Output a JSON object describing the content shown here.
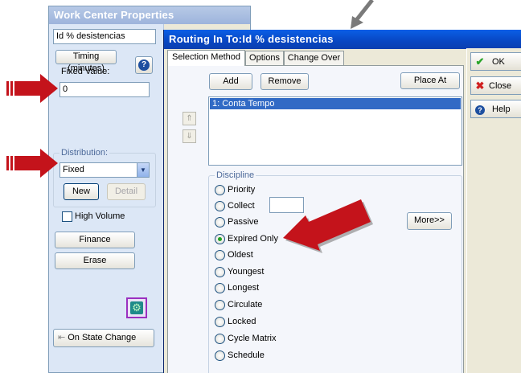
{
  "work_center": {
    "title": "Work Center Properties",
    "name_value": "Id % desistencias",
    "timing_label": "Timing (minutes)",
    "fixed_value_label": "Fixed Value:",
    "fixed_value": "0",
    "distribution_label": "Distribution:",
    "distribution_value": "Fixed",
    "new_label": "New",
    "detail_label": "Detail",
    "high_volume_label": "High Volume",
    "finance_label": "Finance",
    "erase_label": "Erase",
    "on_state_change_label": "On State Change"
  },
  "routing": {
    "title": "Routing In To:Id % desistencias",
    "tabs": [
      {
        "label": "Selection Method"
      },
      {
        "label": "Options"
      },
      {
        "label": "Change Over"
      }
    ],
    "add_label": "Add",
    "remove_label": "Remove",
    "place_at_label": "Place At",
    "list_items": [
      "1: Conta Tempo"
    ],
    "discipline_label": "Discipline",
    "options": [
      {
        "label": "Priority",
        "checked": false
      },
      {
        "label": "Collect",
        "checked": false
      },
      {
        "label": "Passive",
        "checked": false
      },
      {
        "label": "Expired Only",
        "checked": true
      },
      {
        "label": "Oldest",
        "checked": false
      },
      {
        "label": "Youngest",
        "checked": false
      },
      {
        "label": "Longest",
        "checked": false
      },
      {
        "label": "Circulate",
        "checked": false
      },
      {
        "label": "Locked",
        "checked": false
      },
      {
        "label": "Cycle Matrix",
        "checked": false
      },
      {
        "label": "Schedule",
        "checked": false
      }
    ],
    "more_label": "More>>"
  },
  "side_buttons": {
    "ok_label": "OK",
    "close_label": "Close",
    "help_label": "Help"
  },
  "colors": {
    "arrow_red": "#c4131b",
    "arrow_gray": "#7a7a7a",
    "title_blue": "#0846c2",
    "selection_blue": "#316ac5"
  }
}
